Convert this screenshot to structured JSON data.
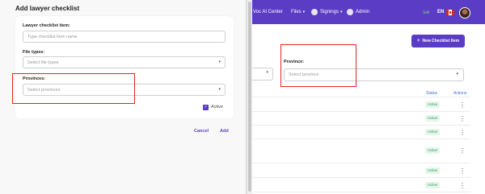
{
  "topbar": {
    "items": [
      {
        "label": "Voc AI Center"
      },
      {
        "label": "Files"
      },
      {
        "label": "Signings"
      },
      {
        "label": "Admin"
      }
    ],
    "status": "Sell",
    "language": "EN"
  },
  "page": {
    "add_button_label": "New Checklist Item",
    "province_filter": {
      "label": "Province:",
      "placeholder": "Select province"
    },
    "table": {
      "headers": {
        "status": "Status",
        "actions": "Actions"
      },
      "rows": [
        {
          "status": "Active"
        },
        {
          "status": "Active"
        },
        {
          "status": "Active"
        },
        {
          "status": "Active"
        },
        {
          "status": "Active"
        },
        {
          "status": "Active"
        }
      ]
    }
  },
  "modal": {
    "title": "Add lawyer checklist",
    "item_field": {
      "label": "Lawyer checklist item:",
      "placeholder": "Type checklist item name"
    },
    "file_types": {
      "label": "File types:",
      "placeholder": "Select file types"
    },
    "provinces": {
      "label": "Provinces:",
      "placeholder": "Select provinces"
    },
    "active_label": "Active",
    "cancel_label": "Cancel",
    "add_label": "Add"
  },
  "colors": {
    "brand": "#5b3cc4",
    "highlight": "#e02424",
    "status_active_bg": "#e4f6ea",
    "status_active_text": "#2d9a55"
  },
  "icons": [
    "chevron-down-icon",
    "gear-icon",
    "plus-icon",
    "more-vert-icon",
    "check-icon",
    "flag-canada-icon",
    "avatar"
  ]
}
